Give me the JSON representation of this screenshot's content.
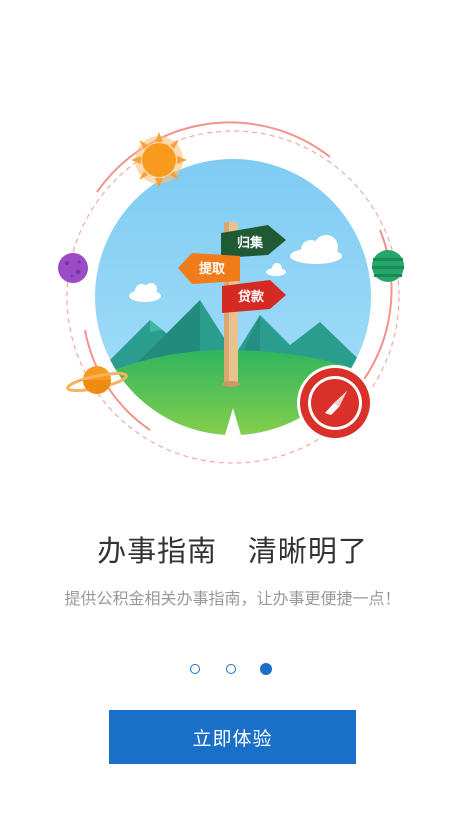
{
  "illustration": {
    "sign_top": "归集",
    "sign_left": "提取",
    "sign_right": "贷款",
    "decorations": [
      "sun-icon",
      "purple-planet-icon",
      "green-planet-icon",
      "ringed-planet-icon",
      "compass-icon"
    ]
  },
  "headline": "办事指南   清晰明了",
  "subtitle": "提供公积金相关办事指南，让办事更便捷一点！",
  "pager": {
    "total": 3,
    "current": 3
  },
  "cta_label": "立即体验",
  "colors": {
    "primary": "#1a6fc9",
    "sky": "#8dd2f6",
    "hill": "#3fbf5e",
    "sign_green": "#1f5a35",
    "sign_orange": "#f07d1a",
    "sign_red": "#d42a22",
    "compass_red": "#d9302a"
  }
}
